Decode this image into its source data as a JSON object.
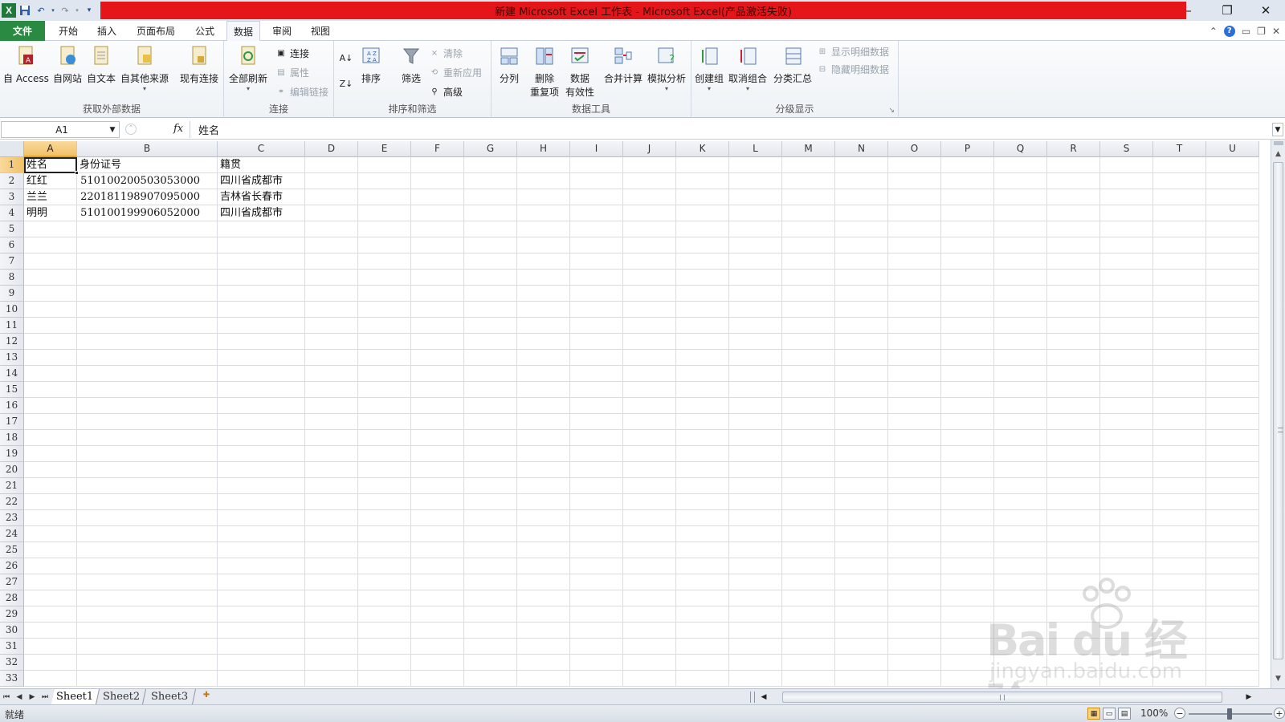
{
  "window": {
    "title": "新建 Microsoft Excel 工作表 - Microsoft Excel(产品激活失败)",
    "app_icon_letter": "X"
  },
  "tabs": [
    {
      "label": "文件",
      "type": "file"
    },
    {
      "label": "开始",
      "type": "normal"
    },
    {
      "label": "插入",
      "type": "normal"
    },
    {
      "label": "页面布局",
      "type": "normal"
    },
    {
      "label": "公式",
      "type": "normal"
    },
    {
      "label": "数据",
      "type": "active"
    },
    {
      "label": "审阅",
      "type": "normal"
    },
    {
      "label": "视图",
      "type": "normal"
    }
  ],
  "ribbon": {
    "groups": {
      "external": "获取外部数据",
      "connections": "连接",
      "sort_filter": "排序和筛选",
      "data_tools": "数据工具",
      "outline": "分级显示"
    },
    "buttons": {
      "from_access": "自 Access",
      "from_web": "自网站",
      "from_text": "自文本",
      "from_other": "自其他来源",
      "existing": "现有连接",
      "refresh_all": "全部刷新",
      "connections": "连接",
      "properties": "属性",
      "edit_links": "编辑链接",
      "sort": "排序",
      "filter": "筛选",
      "clear": "清除",
      "reapply": "重新应用",
      "advanced": "高级",
      "text_to_columns": "分列",
      "remove_dup_1": "删除",
      "remove_dup_2": "重复项",
      "validation_1": "数据",
      "validation_2": "有效性",
      "consolidate": "合并计算",
      "what_if": "模拟分析",
      "group": "创建组",
      "ungroup": "取消组合",
      "subtotal": "分类汇总",
      "show_detail": "显示明细数据",
      "hide_detail": "隐藏明细数据"
    }
  },
  "formula_bar": {
    "name_box": "A1",
    "fx_label": "fx",
    "content": "姓名"
  },
  "grid": {
    "columns": [
      "A",
      "B",
      "C",
      "D",
      "E",
      "F",
      "G",
      "H",
      "I",
      "J",
      "K",
      "L",
      "M",
      "N",
      "O",
      "P",
      "Q",
      "R",
      "S",
      "T",
      "U"
    ],
    "selected_column": "A",
    "visible_rows": 33,
    "selected_row": 1,
    "rows": [
      {
        "A": "姓名",
        "B": "身份证号",
        "C": "籍贯"
      },
      {
        "A": "红红",
        "B": "510100200503053000",
        "C": "四川省成都市"
      },
      {
        "A": "兰兰",
        "B": "220181198907095000",
        "C": "吉林省长春市"
      },
      {
        "A": "明明",
        "B": "510100199906052000",
        "C": "四川省成都市"
      }
    ]
  },
  "sheets": [
    "Sheet1",
    "Sheet2",
    "Sheet3"
  ],
  "active_sheet": "Sheet1",
  "status": {
    "ready": "就绪",
    "zoom": "100%"
  },
  "watermark": {
    "main": "Bai du 经验",
    "sub": "jingyan.baidu.com"
  },
  "colors": {
    "title_bar_red": "#e4161a",
    "file_tab_green": "#2a8a42",
    "selection_header": "#f2c26b"
  }
}
